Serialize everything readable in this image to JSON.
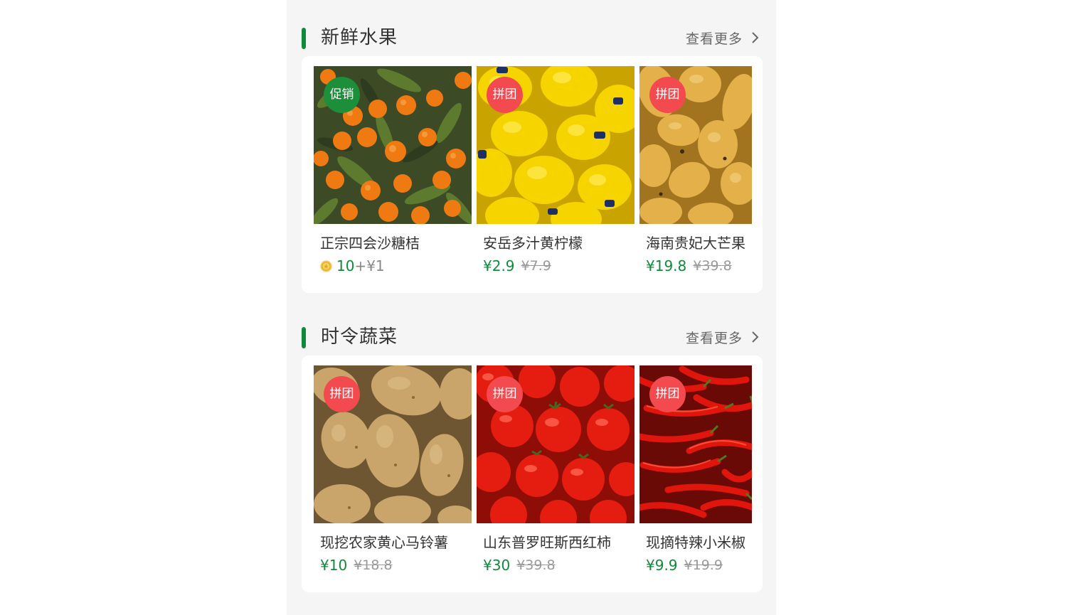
{
  "colors": {
    "accent": "#0e8a3a",
    "badge_group": "#f34a4f",
    "badge_promo": "#1d8f3a",
    "background": "#f5f5f5"
  },
  "sections": [
    {
      "title": "新鲜水果",
      "more_label": "查看更多",
      "more_icon": "chevron-right-icon",
      "products": [
        {
          "name": "正宗四会沙糖桔",
          "badge": "促销",
          "image": "mandarin-oranges",
          "points_icon": "gold-coin-icon",
          "points": "10",
          "plus_price": "+¥1"
        },
        {
          "name": "安岳多汁黄柠檬",
          "badge": "拼团",
          "image": "yellow-lemons",
          "price": "¥2.9",
          "original_price": "¥7.9"
        },
        {
          "name": "海南贵妃大芒果",
          "badge": "拼团",
          "image": "mangoes",
          "price": "¥19.8",
          "original_price": "¥39.8"
        }
      ]
    },
    {
      "title": "时令蔬菜",
      "more_label": "查看更多",
      "more_icon": "chevron-right-icon",
      "products": [
        {
          "name": "现挖农家黄心马铃薯",
          "badge": "拼团",
          "image": "potatoes",
          "price": "¥10",
          "original_price": "¥18.8"
        },
        {
          "name": "山东普罗旺斯西红柿",
          "badge": "拼团",
          "image": "tomatoes",
          "price": "¥30",
          "original_price": "¥39.8"
        },
        {
          "name": "现摘特辣小米椒",
          "badge": "拼团",
          "image": "red-chili-peppers",
          "price": "¥9.9",
          "original_price": "¥19.9"
        }
      ]
    }
  ]
}
